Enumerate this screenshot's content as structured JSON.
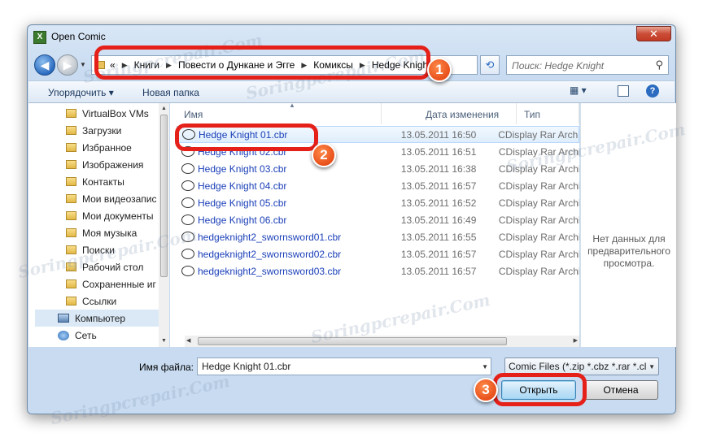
{
  "window": {
    "title": "Open Comic",
    "close_label": "✕"
  },
  "nav": {
    "breadcrumb": [
      "Книги",
      "Повести о Дункане и Эгге",
      "Комиксы",
      "Hedge Knight"
    ],
    "crumb_prefix": "«",
    "search_placeholder": "Поиск: Hedge Knight"
  },
  "toolbar": {
    "organize": "Упорядочить ▾",
    "new_folder": "Новая папка",
    "view": "▦ ▾",
    "help": "?"
  },
  "sidebar": {
    "items": [
      {
        "label": "VirtualBox VMs",
        "icon": "folder-icon"
      },
      {
        "label": "Загрузки",
        "icon": "folder-icon"
      },
      {
        "label": "Избранное",
        "icon": "folder-icon"
      },
      {
        "label": "Изображения",
        "icon": "folder-icon"
      },
      {
        "label": "Контакты",
        "icon": "folder-icon"
      },
      {
        "label": "Мои видеозапис",
        "icon": "folder-icon"
      },
      {
        "label": "Мои документы",
        "icon": "folder-icon"
      },
      {
        "label": "Моя музыка",
        "icon": "folder-icon"
      },
      {
        "label": "Поиски",
        "icon": "folder-icon"
      },
      {
        "label": "Рабочий стол",
        "icon": "folder-icon"
      },
      {
        "label": "Сохраненные иг",
        "icon": "folder-icon"
      },
      {
        "label": "Ссылки",
        "icon": "folder-icon"
      },
      {
        "label": "Компьютер",
        "icon": "computer-icon"
      },
      {
        "label": "Сеть",
        "icon": "network-icon"
      }
    ]
  },
  "files": {
    "columns": {
      "name": "Имя",
      "date": "Дата изменения",
      "type": "Тип"
    },
    "rows": [
      {
        "name": "Hedge Knight 01.cbr",
        "date": "13.05.2011 16:50",
        "type": "CDisplay Rar Archi..."
      },
      {
        "name": "Hedge Knight 02.cbr",
        "date": "13.05.2011 16:51",
        "type": "CDisplay Rar Archi..."
      },
      {
        "name": "Hedge Knight 03.cbr",
        "date": "13.05.2011 16:38",
        "type": "CDisplay Rar Archi..."
      },
      {
        "name": "Hedge Knight 04.cbr",
        "date": "13.05.2011 16:57",
        "type": "CDisplay Rar Archi..."
      },
      {
        "name": "Hedge Knight 05.cbr",
        "date": "13.05.2011 16:52",
        "type": "CDisplay Rar Archi..."
      },
      {
        "name": "Hedge Knight 06.cbr",
        "date": "13.05.2011 16:49",
        "type": "CDisplay Rar Archi..."
      },
      {
        "name": "hedgeknight2_swornsword01.cbr",
        "date": "13.05.2011 16:55",
        "type": "CDisplay Rar Archi..."
      },
      {
        "name": "hedgeknight2_swornsword02.cbr",
        "date": "13.05.2011 16:57",
        "type": "CDisplay Rar Archi..."
      },
      {
        "name": "hedgeknight2_swornsword03.cbr",
        "date": "13.05.2011 16:57",
        "type": "CDisplay Rar Archi..."
      }
    ],
    "selected_index": 0
  },
  "preview": {
    "text": "Нет данных для предварительного просмотра."
  },
  "footer": {
    "filename_label": "Имя файла:",
    "filename_value": "Hedge Knight 01.cbr",
    "filter_value": "Comic Files (*.zip *.cbz *.rar *.cl",
    "open_label": "Открыть",
    "cancel_label": "Отмена"
  },
  "annotations": {
    "badges": [
      "1",
      "2",
      "3"
    ],
    "color": "#e52019"
  },
  "watermark": "Soringpcrepair.Com"
}
